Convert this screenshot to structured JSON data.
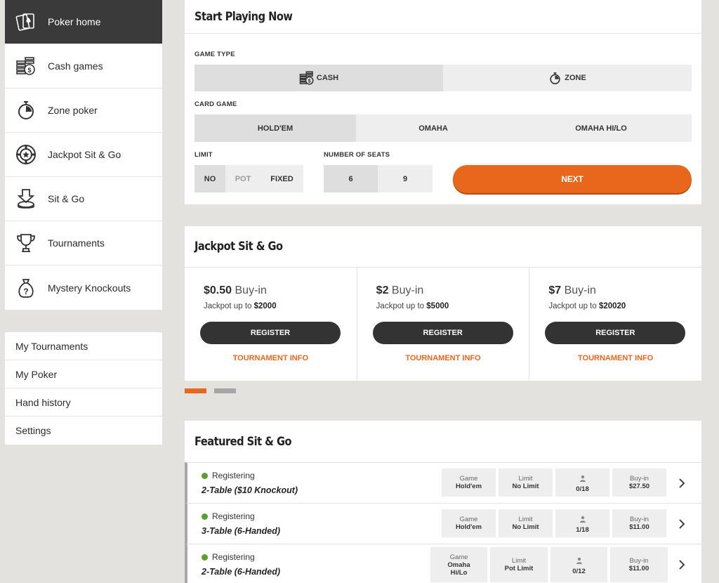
{
  "sidebar": {
    "items": [
      {
        "label": "Poker home",
        "icon": "poker-cards-icon"
      },
      {
        "label": "Cash games",
        "icon": "coin-stack-icon"
      },
      {
        "label": "Zone poker",
        "icon": "stopwatch-icon"
      },
      {
        "label": "Jackpot Sit & Go",
        "icon": "star-chip-icon"
      },
      {
        "label": "Sit & Go",
        "icon": "chip-tray-icon"
      },
      {
        "label": "Tournaments",
        "icon": "trophy-icon"
      },
      {
        "label": "Mystery Knockouts",
        "icon": "mystery-bag-icon"
      }
    ],
    "links": [
      "My Tournaments",
      "My Poker",
      "Hand history",
      "Settings"
    ]
  },
  "start": {
    "title": "Start Playing Now",
    "game_type_label": "GAME TYPE",
    "game_types": [
      "CASH",
      "ZONE"
    ],
    "card_game_label": "CARD GAME",
    "card_games": [
      "HOLD'EM",
      "OMAHA",
      "OMAHA HI/LO"
    ],
    "limit_label": "LIMIT",
    "limits": [
      "NO",
      "POT",
      "FIXED"
    ],
    "seats_label": "NUMBER OF SEATS",
    "seats": [
      "6",
      "9"
    ],
    "next_label": "NEXT"
  },
  "jackpot": {
    "title": "Jackpot Sit & Go",
    "buyin_word": "Buy-in",
    "jackpot_prefix": "Jackpot up to",
    "register_label": "REGISTER",
    "info_label": "TOURNAMENT INFO",
    "cards": [
      {
        "price": "$0.50",
        "jackpot": "$2000"
      },
      {
        "price": "$2",
        "jackpot": "$5000"
      },
      {
        "price": "$7",
        "jackpot": "$20020"
      }
    ],
    "colors": {
      "active_dot": "#e8671d",
      "inactive_dot": "#a6a6a6"
    }
  },
  "featured": {
    "title": "Featured Sit & Go",
    "headers": {
      "game": "Game",
      "limit": "Limit",
      "buyin": "Buy-in"
    },
    "rows": [
      {
        "status": "Registering",
        "name": "2-Table ($10 Knockout)",
        "game": "Hold'em",
        "limit": "No Limit",
        "players": "0/18",
        "buyin": "$27.50"
      },
      {
        "status": "Registering",
        "name": "3-Table (6-Handed)",
        "game": "Hold'em",
        "limit": "No Limit",
        "players": "1/18",
        "buyin": "$11.00"
      },
      {
        "status": "Registering",
        "name": "2-Table (6-Handed)",
        "game": "Omaha Hi/Lo",
        "limit": "Pot Limit",
        "players": "0/12",
        "buyin": "$11.00"
      }
    ]
  },
  "colors": {
    "accent": "#e8671d",
    "dark": "#3a3a3a",
    "status_green": "#5aa02c"
  }
}
